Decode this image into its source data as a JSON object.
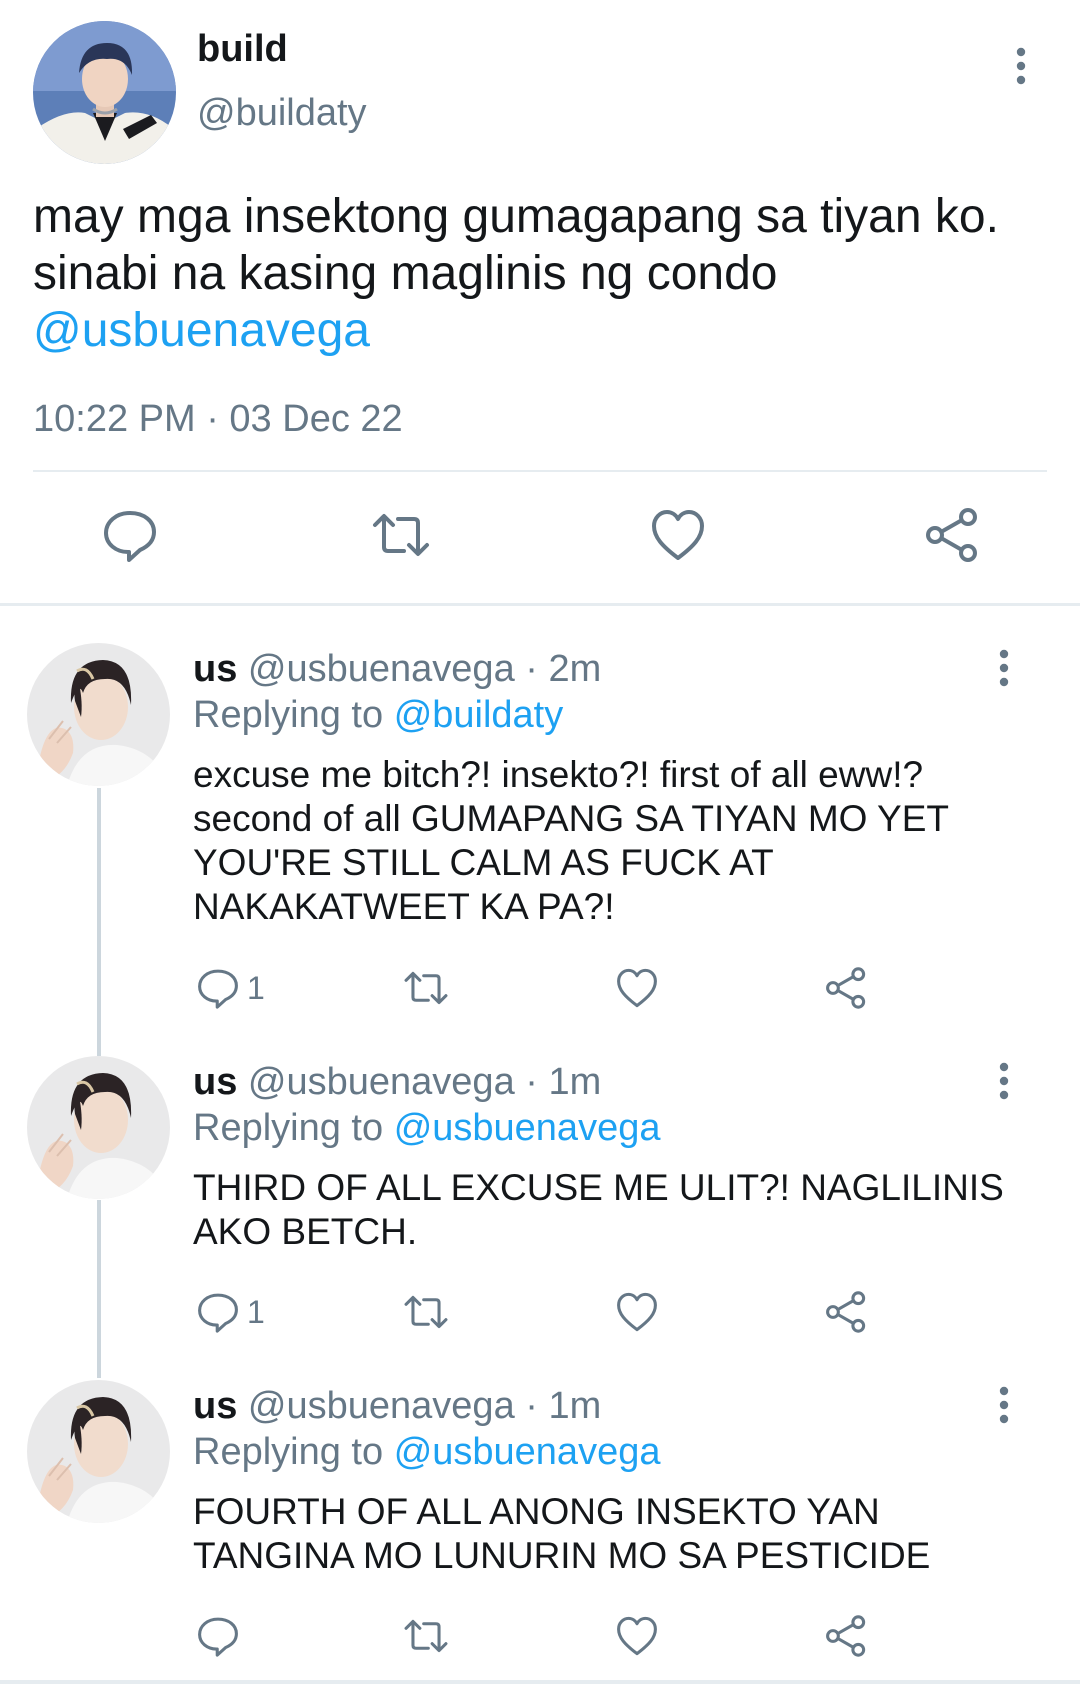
{
  "main_tweet": {
    "name": "build",
    "handle": "@buildaty",
    "text_lines": [
      "may mga insektong gumagapang sa tiyan ko.",
      "sinabi na kasing maglinis ng condo"
    ],
    "mention": "@usbuenavega",
    "timestamp": "10:22 PM · 03 Dec 22"
  },
  "replies": [
    {
      "name": "us",
      "handle": "@usbuenavega",
      "time": "· 2m",
      "replying_prefix": "Replying to",
      "replying_to": "@buildaty",
      "text_lines": [
        "excuse me bitch?! insekto?! first of all eww!?",
        "second of all GUMAPANG SA TIYAN MO YET",
        "YOU'RE STILL CALM AS FUCK AT",
        "NAKAKATWEET KA PA?!"
      ],
      "reply_count": "1"
    },
    {
      "name": "us",
      "handle": "@usbuenavega",
      "time": "· 1m",
      "replying_prefix": "Replying to",
      "replying_to": "@usbuenavega",
      "text_lines": [
        "THIRD OF ALL EXCUSE ME ULIT?! NAGLILINIS",
        "AKO BETCH."
      ],
      "reply_count": "1"
    },
    {
      "name": "us",
      "handle": "@usbuenavega",
      "time": "· 1m",
      "replying_prefix": "Replying to",
      "replying_to": "@usbuenavega",
      "text_lines": [
        "FOURTH OF ALL ANONG INSEKTO YAN",
        "TANGINA MO LUNURIN MO SA PESTICIDE"
      ],
      "reply_count": ""
    }
  ],
  "icons": [
    "comment-icon",
    "retweet-icon",
    "like-icon",
    "share-icon",
    "more-icon"
  ],
  "colors": {
    "link": "#1da1f2",
    "secondary_text": "#657786",
    "primary_text": "#14171a",
    "divider": "#e6ecf0",
    "thread_line": "#ccd6dd"
  }
}
